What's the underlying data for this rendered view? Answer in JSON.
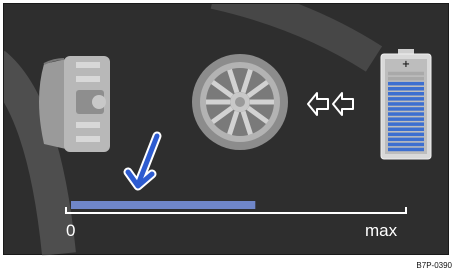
{
  "scale": {
    "min_label": "0",
    "max_label": "max"
  },
  "recovery_level": 0.55,
  "battery": {
    "positive_symbol": "+",
    "charge_level": 0.85
  },
  "figure_ref": "B7P-0390",
  "colors": {
    "background": "#2e2e2e",
    "bar_fill": "#6f86c8",
    "battery_cells": "#3d6fd0",
    "arrow": "#2d5bd0",
    "line": "#ffffff"
  },
  "icons": [
    "brake-caliper-icon",
    "wheel-icon",
    "energy-flow-arrow-icon",
    "battery-icon",
    "pointer-arrow-icon"
  ]
}
